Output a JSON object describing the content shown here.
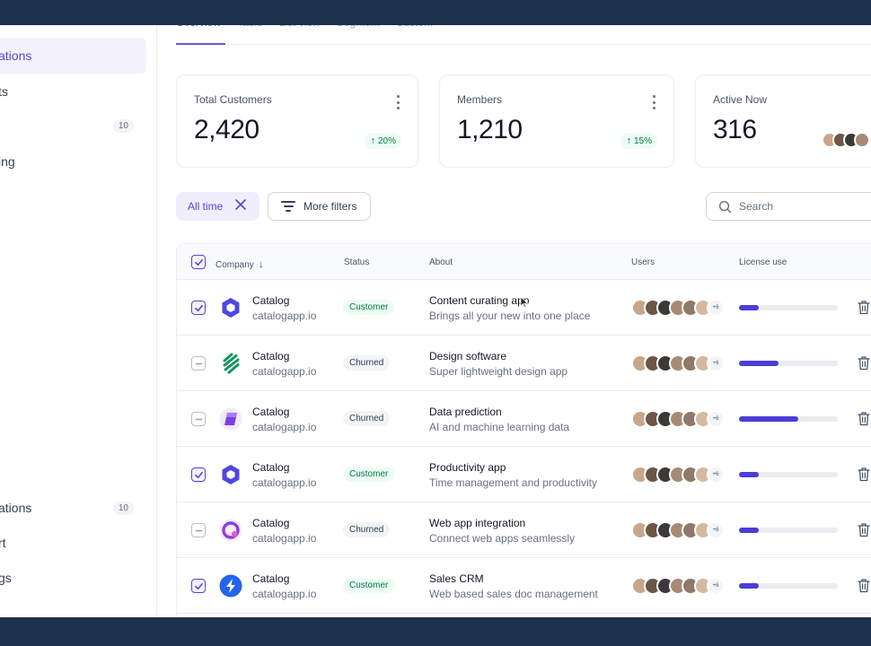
{
  "sidebar": {
    "items": [
      {
        "label": "ations",
        "badge": "",
        "active": true
      },
      {
        "label": "ts",
        "badge": "",
        "active": false
      },
      {
        "label": "",
        "badge": "10",
        "active": false
      },
      {
        "label": "ing",
        "badge": "",
        "active": false
      }
    ],
    "bottom_items": [
      {
        "label": "ations",
        "badge": "10"
      },
      {
        "label": "rt",
        "badge": ""
      },
      {
        "label": "gs",
        "badge": ""
      }
    ]
  },
  "tabs": [
    {
      "label": "Overview",
      "active": true
    },
    {
      "label": "Table",
      "active": false
    },
    {
      "label": "List view",
      "active": false
    },
    {
      "label": "Segment",
      "active": false
    },
    {
      "label": "Custom",
      "active": false
    }
  ],
  "stats": [
    {
      "label": "Total Customers",
      "value": "2,420",
      "delta": "20%"
    },
    {
      "label": "Members",
      "value": "1,210",
      "delta": "15%"
    },
    {
      "label": "Active Now",
      "value": "316",
      "delta": ""
    }
  ],
  "filters": {
    "all_time": "All time",
    "more_filters": "More filters",
    "search_placeholder": "Search"
  },
  "table": {
    "headers": {
      "company": "Company",
      "status": "Status",
      "about": "About",
      "users": "Users",
      "license": "License use"
    },
    "rows": [
      {
        "checked": true,
        "name": "Catalog",
        "domain": "catalogapp.io",
        "status": "Customer",
        "about_title": "Content curating app",
        "about_desc": "Brings all your new into one place",
        "more": "+6",
        "license": 0.2,
        "logo": "hexagon-logo",
        "logo_color": "#4f46e5"
      },
      {
        "checked": false,
        "name": "Catalog",
        "domain": "catalogapp.io",
        "status": "Churned",
        "about_title": "Design software",
        "about_desc": "Super lightweight design app",
        "more": "+6",
        "license": 0.4,
        "logo": "layers-logo",
        "logo_color": "#14945e"
      },
      {
        "checked": false,
        "name": "Catalog",
        "domain": "catalogapp.io",
        "status": "Churned",
        "about_title": "Data prediction",
        "about_desc": "AI and machine learning data",
        "more": "+6",
        "license": 0.6,
        "logo": "cube-logo",
        "logo_color": "#7b3fe4"
      },
      {
        "checked": true,
        "name": "Catalog",
        "domain": "catalogapp.io",
        "status": "Customer",
        "about_title": "Productivity app",
        "about_desc": "Time management and productivity",
        "more": "+6",
        "license": 0.2,
        "logo": "hexagon-logo",
        "logo_color": "#4f46e5"
      },
      {
        "checked": false,
        "name": "Catalog",
        "domain": "catalogapp.io",
        "status": "Churned",
        "about_title": "Web app integration",
        "about_desc": "Connect web apps seamlessly",
        "more": "+6",
        "license": 0.2,
        "logo": "q-logo",
        "logo_color": "#8b3fe0"
      },
      {
        "checked": true,
        "name": "Catalog",
        "domain": "catalogapp.io",
        "status": "Customer",
        "about_title": "Sales CRM",
        "about_desc": "Web based sales doc management",
        "more": "+6",
        "license": 0.2,
        "logo": "bolt-logo",
        "logo_color": "#2563eb"
      }
    ]
  },
  "colors": {
    "accent": "#5b44d4",
    "bar": "#4a3ed6",
    "frame_bg": "#1b3049",
    "avatar_palette": [
      "#c9a68a",
      "#6b5648",
      "#3a3a3a",
      "#a88a74",
      "#8d7a6b",
      "#d4b9a0"
    ]
  }
}
